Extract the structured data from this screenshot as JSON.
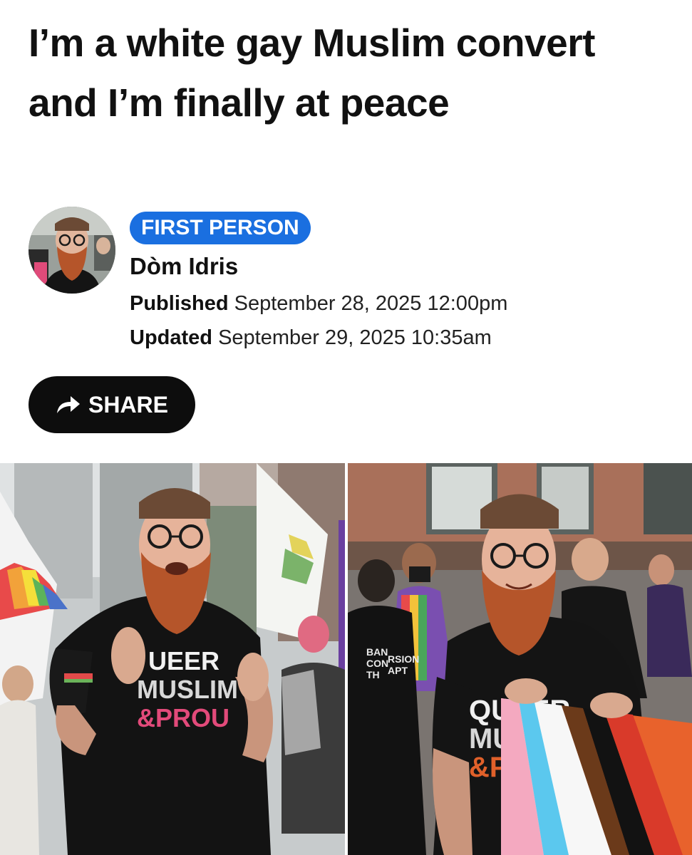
{
  "article": {
    "headline": "I’m a white gay Muslim convert and I’m finally at peace",
    "tag": "FIRST PERSON",
    "author": "Dòm Idris",
    "published_label": "Published",
    "published_value": "September 28, 2025 12:00pm",
    "updated_label": "Updated",
    "updated_value": "September 29, 2025 10:35am"
  },
  "share": {
    "label": "SHARE",
    "icon": "share-arrow-icon"
  },
  "photos": {
    "left_shirt": [
      "UEER",
      "MUSLIM",
      "&PROU"
    ],
    "right_shirt": [
      "QUEER",
      "MU",
      "&P"
    ],
    "bg_shirt": [
      "BAN",
      "CON",
      "TH",
      "RSION",
      "APT"
    ]
  },
  "colors": {
    "tag_bg": "#1a6fe0",
    "share_bg": "#0d0d0d",
    "beard": "#b5552a",
    "kufi": "#6b4a35"
  }
}
